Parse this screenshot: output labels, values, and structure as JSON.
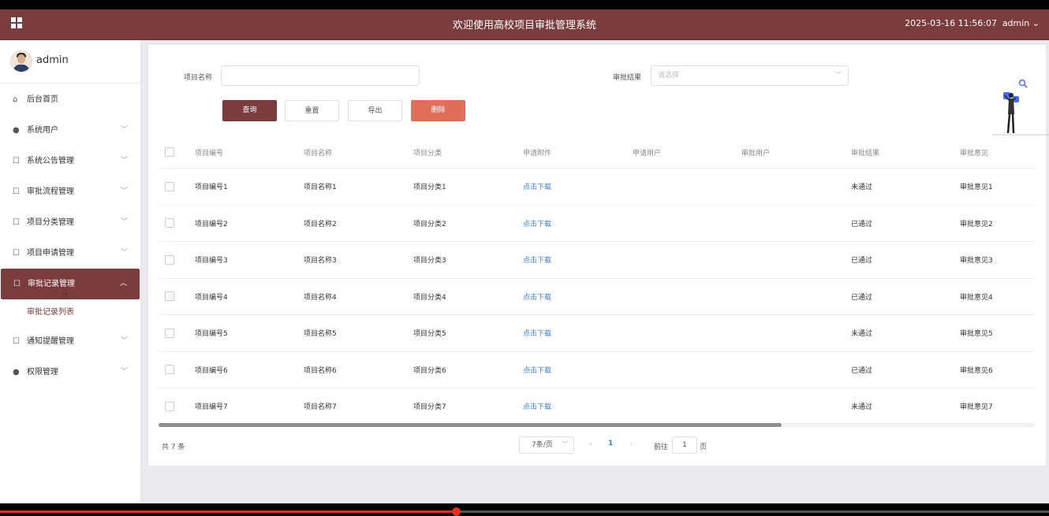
{
  "header": {
    "title": "欢迎使用高校项目审批管理系统",
    "datetime": "2025-03-16 11:56:07",
    "user": "admin"
  },
  "sidebar": {
    "username": "admin",
    "items": [
      {
        "label": "后台首页",
        "icon": "home-icon"
      },
      {
        "label": "系统用户",
        "icon": "user-icon"
      },
      {
        "label": "系统公告管理",
        "icon": "doc-icon"
      },
      {
        "label": "审批流程管理",
        "icon": "doc-icon"
      },
      {
        "label": "项目分类管理",
        "icon": "doc-icon"
      },
      {
        "label": "项目申请管理",
        "icon": "doc-icon"
      },
      {
        "label": "审批记录管理",
        "icon": "doc-icon"
      },
      {
        "label": "通知提醒管理",
        "icon": "doc-icon"
      },
      {
        "label": "权限管理",
        "icon": "user-icon"
      }
    ],
    "active_sub": "审批记录列表"
  },
  "search": {
    "name_label": "项目名称",
    "name_value": "",
    "result_label": "审批结果",
    "result_placeholder": "请选择"
  },
  "buttons": {
    "query": "查询",
    "reset": "重置",
    "export": "导出",
    "delete": "删除"
  },
  "table": {
    "columns": [
      "项目编号",
      "项目名称",
      "项目分类",
      "申请附件",
      "申请用户",
      "审批用户",
      "审批结果",
      "审批意见"
    ],
    "rows": [
      [
        "项目编号1",
        "项目名称1",
        "项目分类1",
        "点击下载",
        "",
        "",
        "未通过",
        "审批意见1"
      ],
      [
        "项目编号2",
        "项目名称2",
        "项目分类2",
        "点击下载",
        "",
        "",
        "已通过",
        "审批意见2"
      ],
      [
        "项目编号3",
        "项目名称3",
        "项目分类3",
        "点击下载",
        "",
        "",
        "已通过",
        "审批意见3"
      ],
      [
        "项目编号4",
        "项目名称4",
        "项目分类4",
        "点击下载",
        "",
        "",
        "已通过",
        "审批意见4"
      ],
      [
        "项目编号5",
        "项目名称5",
        "项目分类5",
        "点击下载",
        "",
        "",
        "未通过",
        "审批意见5"
      ],
      [
        "项目编号6",
        "项目名称6",
        "项目分类6",
        "点击下载",
        "",
        "",
        "已通过",
        "审批意见6"
      ],
      [
        "项目编号7",
        "项目名称7",
        "项目分类7",
        "点击下载",
        "",
        "",
        "未通过",
        "审批意见7"
      ]
    ]
  },
  "pagination": {
    "total": "共 7 条",
    "page_size": "7条/页",
    "current_page": "1",
    "goto_label": "前往",
    "goto_value": "1",
    "goto_unit": "页"
  },
  "colors": {
    "brand": "#7a3c3c",
    "danger": "#e06e5a",
    "link": "#3a7cd5"
  }
}
